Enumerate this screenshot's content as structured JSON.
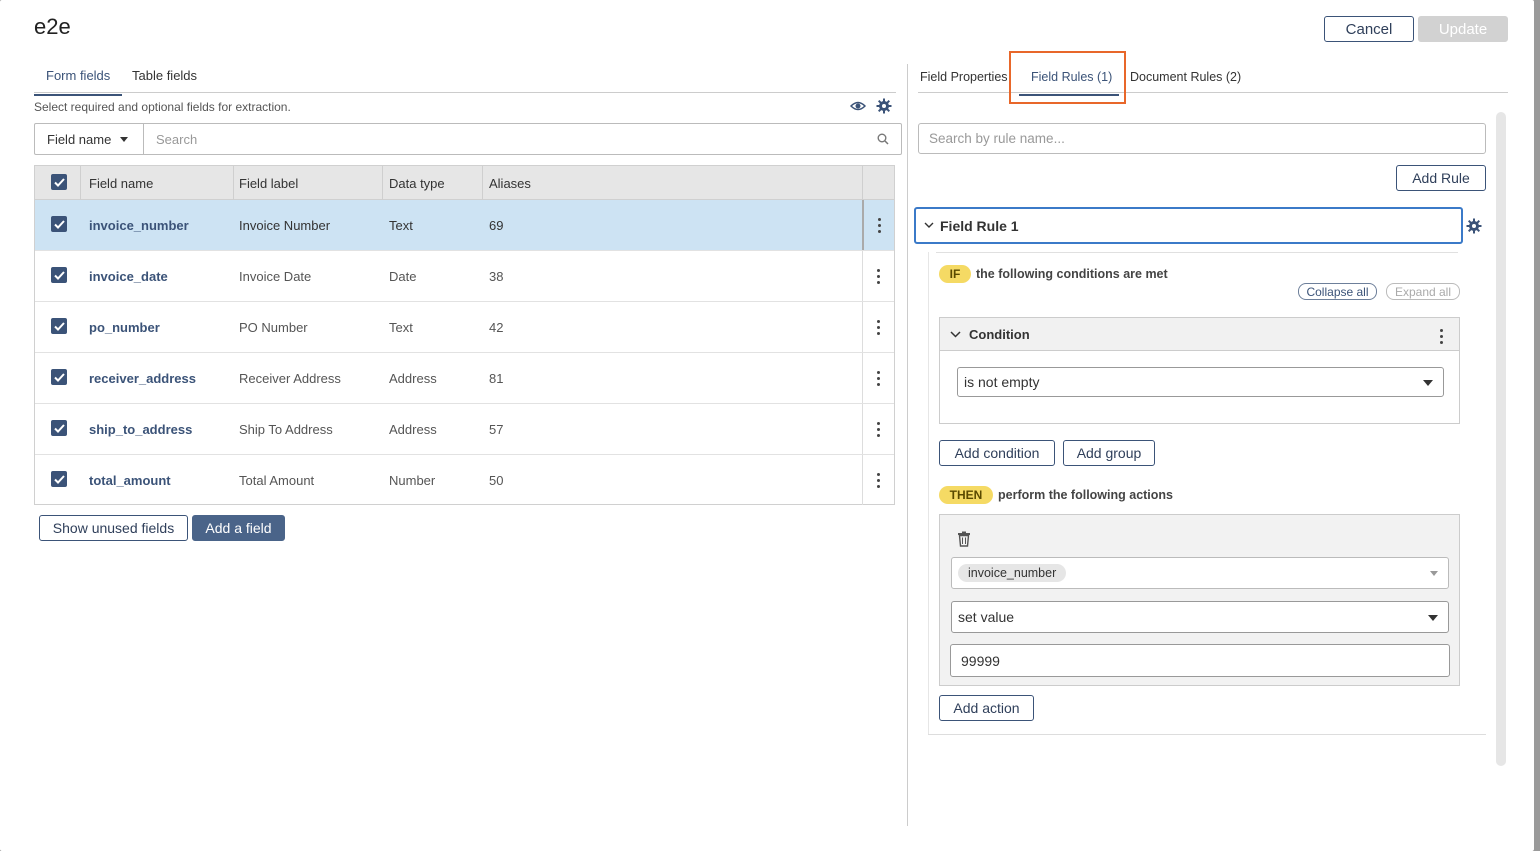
{
  "dialog": {
    "title": "e2e",
    "cancel_label": "Cancel",
    "update_label": "Update"
  },
  "left": {
    "tabs": [
      {
        "label": "Form fields",
        "active": true
      },
      {
        "label": "Table fields",
        "active": false
      }
    ],
    "hint": "Select required and optional fields for extraction.",
    "filter_select": "Field name",
    "search_placeholder": "Search",
    "columns": [
      "Field name",
      "Field label",
      "Data type",
      "Aliases"
    ],
    "rows": [
      {
        "name": "invoice_number",
        "label": "Invoice Number",
        "type": "Text",
        "aliases": "69",
        "selected": true
      },
      {
        "name": "invoice_date",
        "label": "Invoice Date",
        "type": "Date",
        "aliases": "38",
        "selected": false
      },
      {
        "name": "po_number",
        "label": "PO Number",
        "type": "Text",
        "aliases": "42",
        "selected": false
      },
      {
        "name": "receiver_address",
        "label": "Receiver Address",
        "type": "Address",
        "aliases": "81",
        "selected": false
      },
      {
        "name": "ship_to_address",
        "label": "Ship To Address",
        "type": "Address",
        "aliases": "57",
        "selected": false
      },
      {
        "name": "total_amount",
        "label": "Total Amount",
        "type": "Number",
        "aliases": "50",
        "selected": false
      }
    ],
    "show_unused_label": "Show unused fields",
    "add_field_label": "Add a field"
  },
  "right": {
    "tabs": [
      {
        "label": "Field Properties",
        "active": false
      },
      {
        "label": "Field Rules (1)",
        "active": true
      },
      {
        "label": "Document Rules (2)",
        "active": false
      }
    ],
    "rule_search_placeholder": "Search by rule name...",
    "add_rule_label": "Add Rule",
    "rule": {
      "title": "Field Rule 1",
      "if_badge": "IF",
      "if_text": "the following conditions are met",
      "collapse_all": "Collapse all",
      "expand_all": "Expand all",
      "condition_title": "Condition",
      "condition_value": "is not empty",
      "add_condition": "Add condition",
      "add_group": "Add group",
      "then_badge": "THEN",
      "then_text": "perform the following actions",
      "action_field": "invoice_number",
      "action_type": "set value",
      "action_value": "99999",
      "add_action": "Add action"
    }
  },
  "colors": {
    "accent": "#3b5378",
    "highlight": "#e8672a",
    "selected_row": "#cde3f3",
    "badge": "#f5da64"
  }
}
